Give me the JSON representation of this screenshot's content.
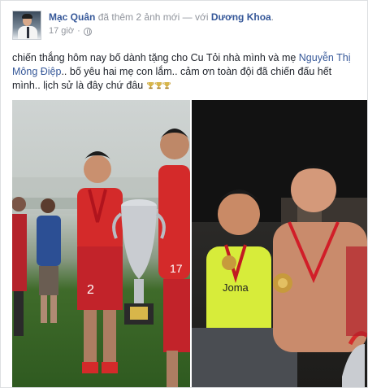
{
  "post": {
    "author": "Mạc Quân",
    "action": " đã thêm 2 ảnh mới — với ",
    "tagged": "Dương Khoa",
    "tagged_suffix": ".",
    "time": "17 giờ",
    "dot": "·",
    "privacy_icon": "globe-icon",
    "message": {
      "part1": "chiến thắng hôm nay bố dành tặng cho Cu Tỏi nhà mình và mẹ ",
      "mention": "Nguyễn Thị Mông Điệp",
      "part2": ".. bố yêu hai mẹ con lắm.. cảm ơn toàn đội đã chiến đấu hết mình.. lịch sử là đây chứ đâu ",
      "emoji": "trophy-icon"
    }
  },
  "photos": [
    {
      "name": "photo-team-trophy-field",
      "jersey_left": "2",
      "jersey_right": "17"
    },
    {
      "name": "photo-locker-room-medals",
      "shirt_text": "Joma"
    }
  ],
  "colors": {
    "link": "#365899",
    "text": "#1d2129",
    "meta": "#90949c",
    "jersey_red": "#d42a2a",
    "trophy_gold": "#d8b64a",
    "trophy_silver": "#c9ccd1"
  }
}
